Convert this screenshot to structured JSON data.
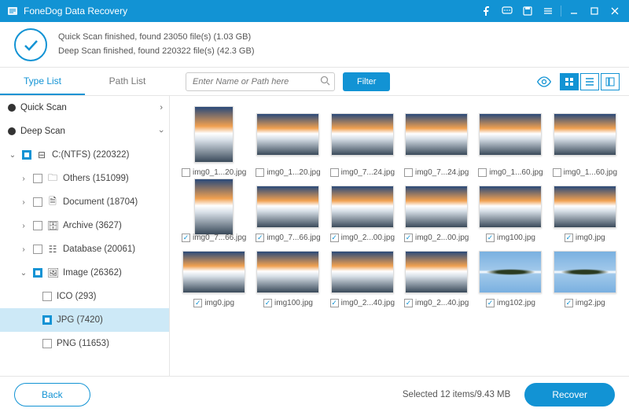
{
  "titlebar": {
    "title": "FoneDog Data Recovery"
  },
  "status": {
    "line1": "Quick Scan finished, found 23050 file(s) (1.03 GB)",
    "line2": "Deep Scan finished, found 220322 file(s) (42.3 GB)"
  },
  "tabs": {
    "type_list": "Type List",
    "path_list": "Path List"
  },
  "search": {
    "placeholder": "Enter Name or Path here"
  },
  "filter_label": "Filter",
  "tree": {
    "quick_scan": "Quick Scan",
    "deep_scan": "Deep Scan",
    "drive": "C:(NTFS) (220322)",
    "others": "Others (151099)",
    "document": "Document (18704)",
    "archive": "Archive (3627)",
    "database": "Database (20061)",
    "image": "Image (26362)",
    "ico": "ICO (293)",
    "jpg": "JPG (7420)",
    "png": "PNG (11653)"
  },
  "grid": {
    "row1": [
      {
        "name": "img0_1...20.jpg",
        "checked": false,
        "tall": true
      },
      {
        "name": "img0_1...20.jpg",
        "checked": false,
        "tall": false
      },
      {
        "name": "img0_7...24.jpg",
        "checked": false,
        "tall": false
      },
      {
        "name": "img0_7...24.jpg",
        "checked": false,
        "tall": false
      },
      {
        "name": "img0_1...60.jpg",
        "checked": false,
        "tall": false
      },
      {
        "name": "img0_1...60.jpg",
        "checked": false,
        "tall": false
      }
    ],
    "row2": [
      {
        "name": "img0_7...66.jpg",
        "checked": true,
        "tall": true
      },
      {
        "name": "img0_7...66.jpg",
        "checked": true,
        "tall": false
      },
      {
        "name": "img0_2...00.jpg",
        "checked": true,
        "tall": false
      },
      {
        "name": "img0_2...00.jpg",
        "checked": true,
        "tall": false
      },
      {
        "name": "img100.jpg",
        "checked": true,
        "tall": false
      },
      {
        "name": "img0.jpg",
        "checked": true,
        "tall": false
      }
    ],
    "row3": [
      {
        "name": "img0.jpg",
        "checked": true,
        "tall": false
      },
      {
        "name": "img100.jpg",
        "checked": true,
        "tall": false
      },
      {
        "name": "img0_2...40.jpg",
        "checked": true,
        "tall": false
      },
      {
        "name": "img0_2...40.jpg",
        "checked": true,
        "tall": false
      },
      {
        "name": "img102.jpg",
        "checked": true,
        "tall": false,
        "island": true
      },
      {
        "name": "img2.jpg",
        "checked": true,
        "tall": false,
        "island": true
      }
    ]
  },
  "footer": {
    "back": "Back",
    "selected": "Selected 12 items/9.43 MB",
    "recover": "Recover"
  }
}
